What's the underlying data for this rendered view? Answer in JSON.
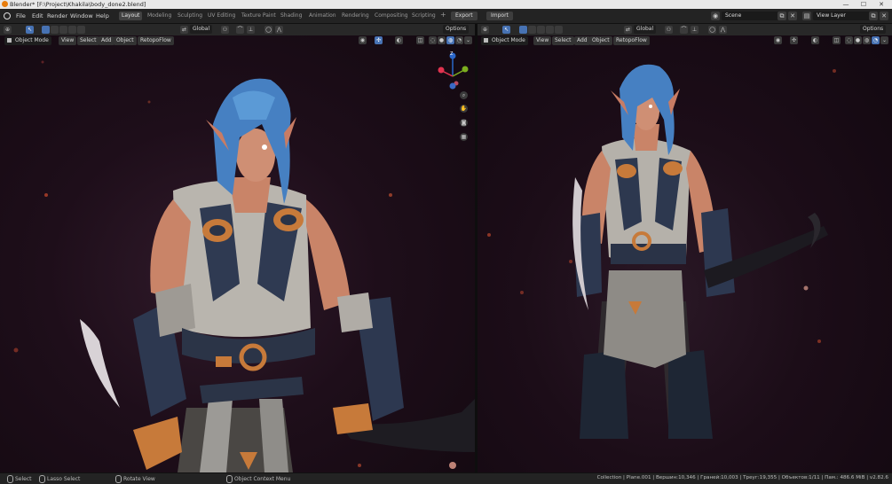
{
  "window": {
    "title": "Blender* [F:\\Project\\Khakila\\body_done2.blend]",
    "minimize": "—",
    "maximize": "☐",
    "close": "✕"
  },
  "menu": [
    "File",
    "Edit",
    "Render",
    "Window",
    "Help"
  ],
  "workspaces": [
    "Layout",
    "Modeling",
    "Sculpting",
    "UV Editing",
    "Texture Paint",
    "Shading",
    "Animation",
    "Rendering",
    "Compositing",
    "Scripting"
  ],
  "active_workspace": "Layout",
  "add_workspace": "+",
  "addons": {
    "export": "Export",
    "import": "Import"
  },
  "scene": {
    "label": "Scene"
  },
  "view_layer": {
    "label": "View Layer"
  },
  "left_view": {
    "orientation": "Global",
    "options": "Options",
    "mode": "Object Mode",
    "menus": [
      "View",
      "Select",
      "Add",
      "Object",
      "RetopoFlow"
    ]
  },
  "right_view": {
    "orientation": "Global",
    "options": "Options",
    "mode": "Object Mode",
    "menus": [
      "View",
      "Select",
      "Add",
      "Object",
      "RetopoFlow"
    ]
  },
  "gizmo": {
    "x": "X",
    "y": "Y",
    "z": "Z"
  },
  "status": {
    "select": "Select",
    "lasso": "Lasso Select",
    "rotate": "Rotate View",
    "context": "Object Context Menu",
    "stats": "Collection | Plane.001 | Вершин:10,346 | Граней:10,003 | Треуг:19,355 | Объектов:1/11 | Пам.: 486.6 MiB | v2.82.6"
  },
  "colors": {
    "accent": "#4772b3",
    "hair": "#4a86c8",
    "leather": "#2c3a52",
    "copper": "#c87a3c",
    "cloth": "#b8b6b2",
    "skin": "#c98c70",
    "ember": "#ff6a3a"
  },
  "icons": [
    "blender-logo-icon",
    "cursor-icon",
    "select-box-icon",
    "transform-icon",
    "snap-icon",
    "proportional-icon",
    "zoom-icon",
    "hand-icon",
    "camera-icon",
    "grid-icon",
    "mouse-icon"
  ]
}
